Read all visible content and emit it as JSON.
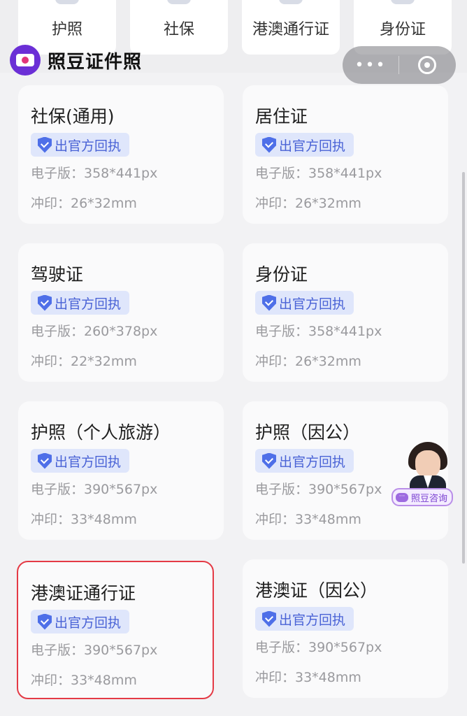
{
  "top_categories": [
    {
      "label": "护照"
    },
    {
      "label": "社保"
    },
    {
      "label": "港澳通行证"
    },
    {
      "label": "身份证"
    }
  ],
  "header": {
    "brand": "照豆证件照",
    "logo_icon": "camera-icon"
  },
  "capsule": {
    "more": "•••",
    "close_icon": "target-icon"
  },
  "badge_text": "出官方回执",
  "cards": [
    {
      "title": "社保(通用)",
      "digital": "电子版：358*441px",
      "print": "冲印：26*32mm"
    },
    {
      "title": "居住证",
      "digital": "电子版：358*441px",
      "print": "冲印：26*32mm"
    },
    {
      "title": "驾驶证",
      "digital": "电子版：260*378px",
      "print": "冲印：22*32mm"
    },
    {
      "title": "身份证",
      "digital": "电子版：358*441px",
      "print": "冲印：26*32mm"
    },
    {
      "title": "护照（个人旅游）",
      "digital": "电子版：390*567px",
      "print": "冲印：33*48mm"
    },
    {
      "title": "护照（因公）",
      "digital": "电子版：390*567px",
      "print": "冲印：33*48mm"
    },
    {
      "title": "港澳证通行证",
      "digital": "电子版：390*567px",
      "print": "冲印：33*48mm",
      "selected": true
    },
    {
      "title": "港澳证（因公）",
      "digital": "电子版：390*567px",
      "print": "冲印：33*48mm"
    }
  ],
  "consult": {
    "label": "照豆咨询",
    "bubble": "···"
  },
  "colors": {
    "accent": "#4a63d6",
    "brand": "#6b2fd6",
    "selected_border": "#e43a45"
  }
}
